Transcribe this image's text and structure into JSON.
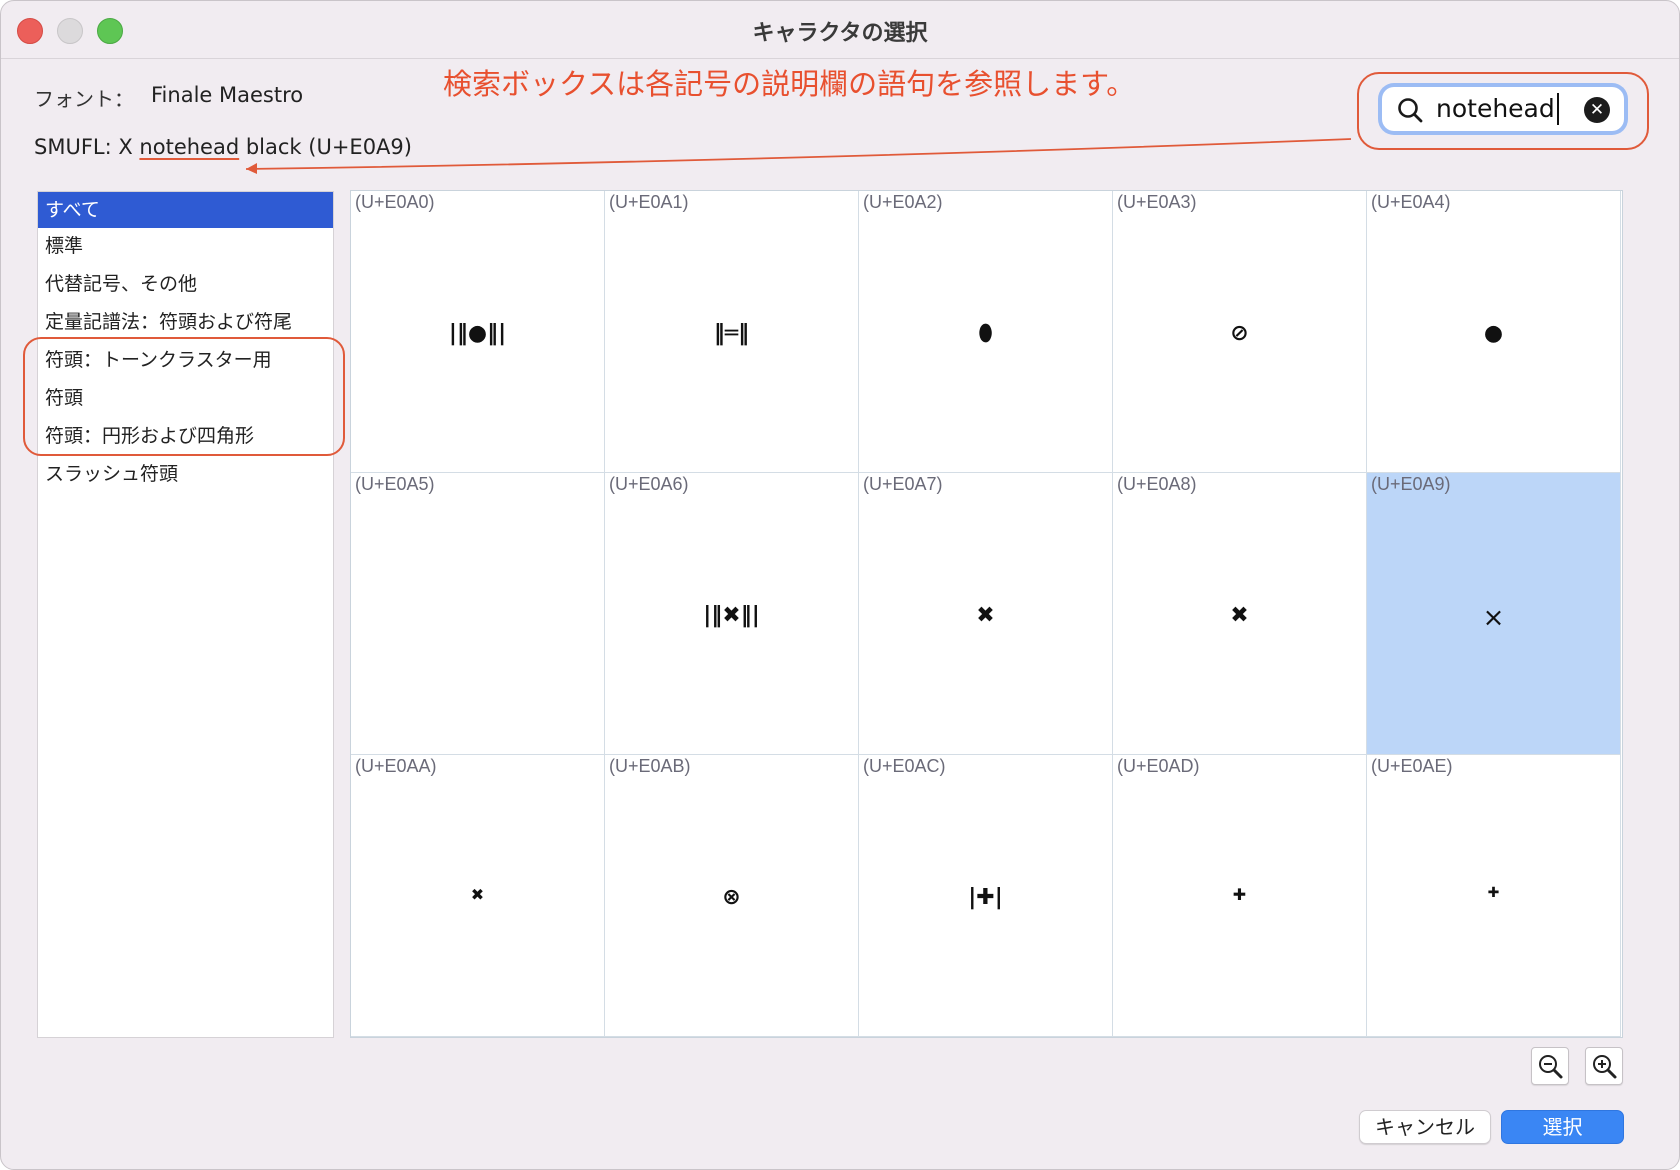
{
  "window": {
    "title": "キャラクタの選択"
  },
  "font": {
    "label": "フォント：",
    "name": "Finale Maestro"
  },
  "smufl": {
    "prefix": "SMUFL: X ",
    "highlight": "notehead",
    "suffix": " black (U+E0A9)"
  },
  "annotation": {
    "text": "検索ボックスは各記号の説明欄の語句を参照します。",
    "color": "#e8502f"
  },
  "search": {
    "value": "notehead",
    "icon": "magnifier-icon",
    "clear_icon": "clear-circle-icon"
  },
  "categories": [
    {
      "label": "すべて",
      "selected": true
    },
    {
      "label": "標準"
    },
    {
      "label": "代替記号、その他"
    },
    {
      "label": "定量記譜法：符頭および符尾"
    },
    {
      "label": "符頭：トーンクラスター用"
    },
    {
      "label": "符頭"
    },
    {
      "label": "符頭：円形および四角形"
    },
    {
      "label": "スラッシュ符頭"
    }
  ],
  "grid": {
    "selected_code": "(U+E0A9)",
    "cells": [
      {
        "code": "(U+E0A0)",
        "glyph": "|‖●‖|"
      },
      {
        "code": "(U+E0A1)",
        "glyph": "‖═‖"
      },
      {
        "code": "(U+E0A2)",
        "glyph": "⬮"
      },
      {
        "code": "(U+E0A3)",
        "glyph": "⊘"
      },
      {
        "code": "(U+E0A4)",
        "glyph": "●"
      },
      {
        "code": "(U+E0A5)",
        "glyph": ""
      },
      {
        "code": "(U+E0A6)",
        "glyph": "|‖✖‖|"
      },
      {
        "code": "(U+E0A7)",
        "glyph": "✖"
      },
      {
        "code": "(U+E0A8)",
        "glyph": "✖"
      },
      {
        "code": "(U+E0A9)",
        "glyph": "×"
      },
      {
        "code": "(U+E0AA)",
        "glyph": "✖"
      },
      {
        "code": "(U+E0AB)",
        "glyph": "⊗"
      },
      {
        "code": "(U+E0AC)",
        "glyph": "|✚|"
      },
      {
        "code": "(U+E0AD)",
        "glyph": "✚"
      },
      {
        "code": "(U+E0AE)",
        "glyph": "✚"
      }
    ]
  },
  "zoom": {
    "out_icon": "zoom-out-icon",
    "in_icon": "zoom-in-icon"
  },
  "buttons": {
    "cancel": "キャンセル",
    "ok": "選択"
  },
  "colors": {
    "accent": "#3a86f4",
    "list_selection": "#2f5bd3",
    "cell_selection": "#bcd6f8",
    "annotation": "#e05a3a"
  }
}
